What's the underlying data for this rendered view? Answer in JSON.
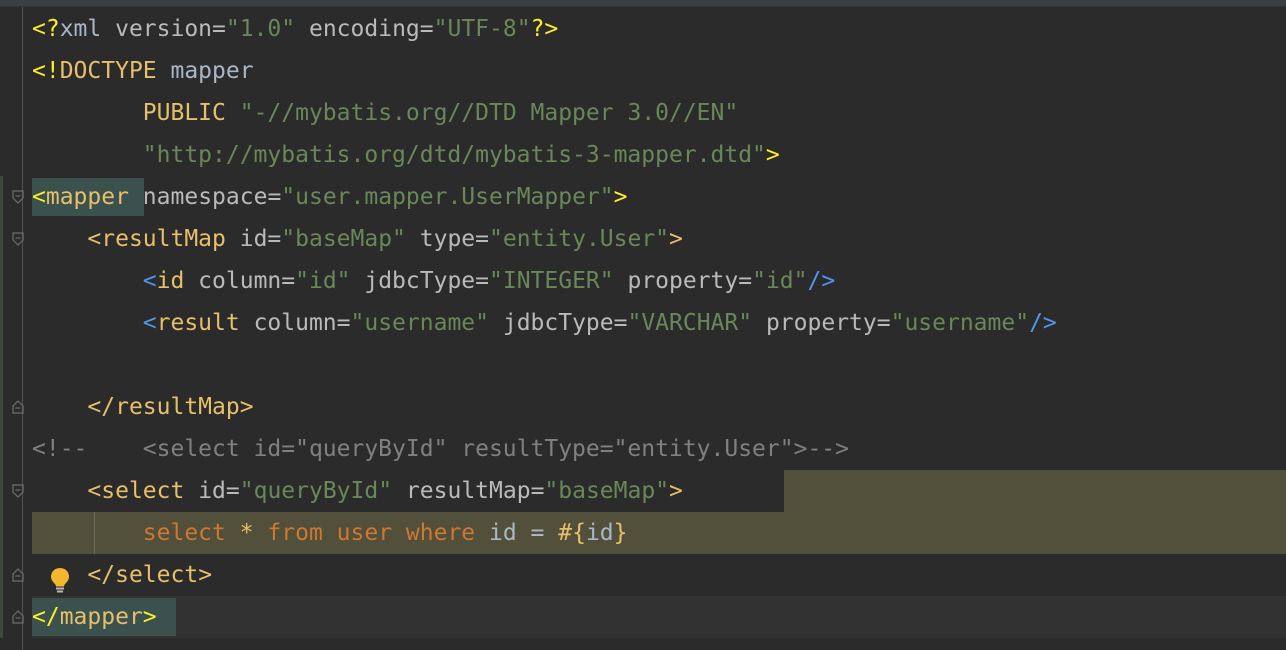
{
  "editor": {
    "lines": [
      {
        "id": "l1",
        "tokens": [
          {
            "t": "<?",
            "c": "c-yellowb"
          },
          {
            "t": "xml",
            "c": "c-text"
          },
          {
            "t": " version",
            "c": "c-attr"
          },
          {
            "t": "=",
            "c": "c-eq"
          },
          {
            "t": "\"1.0\"",
            "c": "c-str"
          },
          {
            "t": " encoding",
            "c": "c-attr"
          },
          {
            "t": "=",
            "c": "c-eq"
          },
          {
            "t": "\"UTF-8\"",
            "c": "c-str"
          },
          {
            "t": "?>",
            "c": "c-yellowb"
          }
        ]
      },
      {
        "id": "l2",
        "tokens": [
          {
            "t": "<!",
            "c": "c-yellowb"
          },
          {
            "t": "DOCTYPE",
            "c": "c-decl"
          },
          {
            "t": " mapper",
            "c": "c-text"
          }
        ]
      },
      {
        "id": "l3",
        "tokens": [
          {
            "t": "        PUBLIC",
            "c": "c-publ"
          },
          {
            "t": " \"-//mybatis.org//DTD Mapper 3.0//EN\"",
            "c": "c-str"
          }
        ]
      },
      {
        "id": "l4",
        "tokens": [
          {
            "t": "        \"http://mybatis.org/dtd/mybatis-3-mapper.dtd\"",
            "c": "c-str"
          },
          {
            "t": ">",
            "c": "c-yellowb"
          }
        ]
      },
      {
        "id": "l5",
        "tokens": [
          {
            "t": "<",
            "c": "c-yellowb"
          },
          {
            "t": "mapper",
            "c": "c-tag"
          },
          {
            "t": " namespace",
            "c": "c-attr"
          },
          {
            "t": "=",
            "c": "c-eq"
          },
          {
            "t": "\"user.mapper.UserMapper\"",
            "c": "c-str"
          },
          {
            "t": ">",
            "c": "c-yellowb"
          }
        ]
      },
      {
        "id": "l6",
        "tokens": [
          {
            "t": "    <",
            "c": "c-bracket"
          },
          {
            "t": "resultMap",
            "c": "c-tag"
          },
          {
            "t": " id",
            "c": "c-attr"
          },
          {
            "t": "=",
            "c": "c-eq"
          },
          {
            "t": "\"baseMap\"",
            "c": "c-str"
          },
          {
            "t": " type",
            "c": "c-attr"
          },
          {
            "t": "=",
            "c": "c-eq"
          },
          {
            "t": "\"entity.User\"",
            "c": "c-str"
          },
          {
            "t": ">",
            "c": "c-bracket"
          }
        ]
      },
      {
        "id": "l7",
        "tokens": [
          {
            "t": "        <",
            "c": "c-blue"
          },
          {
            "t": "id",
            "c": "c-tag"
          },
          {
            "t": " column",
            "c": "c-attr"
          },
          {
            "t": "=",
            "c": "c-eq"
          },
          {
            "t": "\"id\"",
            "c": "c-str"
          },
          {
            "t": " jdbcType",
            "c": "c-attr"
          },
          {
            "t": "=",
            "c": "c-eq"
          },
          {
            "t": "\"INTEGER\"",
            "c": "c-str"
          },
          {
            "t": " property",
            "c": "c-attr"
          },
          {
            "t": "=",
            "c": "c-eq"
          },
          {
            "t": "\"id\"",
            "c": "c-str"
          },
          {
            "t": "/>",
            "c": "c-blue"
          }
        ]
      },
      {
        "id": "l8",
        "tokens": [
          {
            "t": "        <",
            "c": "c-blue"
          },
          {
            "t": "result",
            "c": "c-tag"
          },
          {
            "t": " column",
            "c": "c-attr"
          },
          {
            "t": "=",
            "c": "c-eq"
          },
          {
            "t": "\"username\"",
            "c": "c-str"
          },
          {
            "t": " jdbcType",
            "c": "c-attr"
          },
          {
            "t": "=",
            "c": "c-eq"
          },
          {
            "t": "\"VARCHAR\"",
            "c": "c-str"
          },
          {
            "t": " property",
            "c": "c-attr"
          },
          {
            "t": "=",
            "c": "c-eq"
          },
          {
            "t": "\"username\"",
            "c": "c-str"
          },
          {
            "t": "/>",
            "c": "c-blue"
          }
        ]
      },
      {
        "id": "l9",
        "tokens": []
      },
      {
        "id": "l10",
        "tokens": [
          {
            "t": "    </",
            "c": "c-bracket"
          },
          {
            "t": "resultMap",
            "c": "c-tag"
          },
          {
            "t": ">",
            "c": "c-bracket"
          }
        ]
      },
      {
        "id": "l11",
        "tokens": [
          {
            "t": "<!--    <select id=\"queryById\" resultType=\"entity.User\">-->",
            "c": "c-comment"
          }
        ]
      },
      {
        "id": "l12",
        "tokens": [
          {
            "t": "    <",
            "c": "c-bracket"
          },
          {
            "t": "select",
            "c": "c-tag"
          },
          {
            "t": " id",
            "c": "c-attr"
          },
          {
            "t": "=",
            "c": "c-eq"
          },
          {
            "t": "\"queryById\"",
            "c": "c-str"
          },
          {
            "t": " resultMap",
            "c": "c-attr"
          },
          {
            "t": "=",
            "c": "c-eq"
          },
          {
            "t": "\"baseMap\"",
            "c": "c-str"
          },
          {
            "t": ">",
            "c": "c-bracket"
          }
        ]
      },
      {
        "id": "l13",
        "tokens": [
          {
            "t": "        select",
            "c": "c-kw"
          },
          {
            "t": " * ",
            "c": "c-publ"
          },
          {
            "t": "from",
            "c": "c-kw"
          },
          {
            "t": " user ",
            "c": "c-kw"
          },
          {
            "t": "where",
            "c": "c-kw"
          },
          {
            "t": " id ",
            "c": "c-id"
          },
          {
            "t": "= ",
            "c": "c-id"
          },
          {
            "t": "#{",
            "c": "c-publ"
          },
          {
            "t": "id",
            "c": "c-id"
          },
          {
            "t": "}",
            "c": "c-publ"
          }
        ]
      },
      {
        "id": "l14",
        "tokens": [
          {
            "t": "    </",
            "c": "c-bracket"
          },
          {
            "t": "select",
            "c": "c-tag"
          },
          {
            "t": ">",
            "c": "c-bracket"
          }
        ]
      },
      {
        "id": "l15",
        "tokens": [
          {
            "t": "</",
            "c": "c-yellowb"
          },
          {
            "t": "mapper",
            "c": "c-tag"
          },
          {
            "t": ">",
            "c": "c-yellowb"
          }
        ]
      }
    ]
  },
  "gutter": {
    "fold_icons": [
      "fold-open-icon",
      "fold-open-icon",
      "fold-close-icon",
      "fold-open-icon",
      "fold-close-icon",
      "fold-close-icon"
    ],
    "intention_icon": "lightbulb-icon"
  },
  "colors": {
    "background": "#2b2b2b",
    "selection_highlight": "#52503a",
    "caret_row": "#323232",
    "tag_match": "#3b514d"
  }
}
